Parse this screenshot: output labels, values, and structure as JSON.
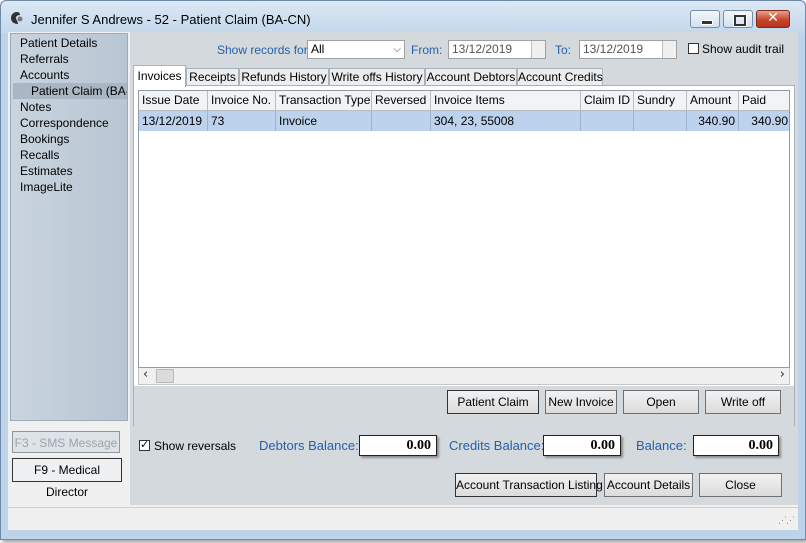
{
  "window": {
    "title": "Jennifer S Andrews - 52 - Patient Claim (BA-CN)"
  },
  "sidebar": {
    "items": [
      {
        "label": "Patient Details"
      },
      {
        "label": "Referrals"
      },
      {
        "label": "Accounts"
      },
      {
        "label": "Patient Claim (BA-CN)",
        "selected": true
      },
      {
        "label": "Notes"
      },
      {
        "label": "Correspondence"
      },
      {
        "label": "Bookings"
      },
      {
        "label": "Recalls"
      },
      {
        "label": "Estimates"
      },
      {
        "label": "ImageLite"
      }
    ],
    "sms_button": "F3 - SMS Message",
    "medical_director_button": "F9 - Medical Director"
  },
  "filters": {
    "show_records_label": "Show records for:",
    "show_records_value": "All",
    "from_label": "From:",
    "from_value": "13/12/2019",
    "to_label": "To:",
    "to_value": "13/12/2019",
    "audit_trail_label": "Show audit trail",
    "audit_trail_checked": false
  },
  "tabs": [
    {
      "label": "Invoices",
      "active": true
    },
    {
      "label": "Receipts"
    },
    {
      "label": "Refunds History"
    },
    {
      "label": "Write offs History"
    },
    {
      "label": "Account Debtors"
    },
    {
      "label": "Account Credits"
    }
  ],
  "table": {
    "columns": [
      "Issue Date",
      "Invoice No.",
      "Transaction Type",
      "Reversed",
      "Invoice Items",
      "Claim ID",
      "Sundry",
      "Amount",
      "Paid"
    ],
    "rows": [
      [
        "13/12/2019",
        "73",
        "Invoice",
        "",
        "304, 23, 55008",
        "",
        "",
        "340.90",
        "340.90"
      ]
    ]
  },
  "actions": {
    "patient_claim": "Patient Claim",
    "new_invoice": "New Invoice",
    "open": "Open",
    "write_off": "Write off"
  },
  "footer": {
    "show_reversals_label": "Show reversals",
    "show_reversals_checked": true,
    "debtors_balance_label": "Debtors Balance:",
    "debtors_balance_value": "0.00",
    "credits_balance_label": "Credits Balance:",
    "credits_balance_value": "0.00",
    "balance_label": "Balance:",
    "balance_value": "0.00",
    "account_transaction_listing": "Account Transaction Listing",
    "account_details": "Account Details",
    "close": "Close"
  },
  "colors": {
    "accent_label": "#2560a8",
    "selected_row": "#bdd2ec",
    "sidebar_bg": "#c2cfdb",
    "close_button": "#c7442b"
  },
  "icons": {
    "app": "app-logo-icon",
    "minimize": "minimize-icon",
    "maximize": "maximize-icon",
    "close": "close-icon",
    "dropdown": "chevron-down-icon",
    "scroll_left": "scroll-left-icon",
    "scroll_right": "scroll-right-icon"
  }
}
